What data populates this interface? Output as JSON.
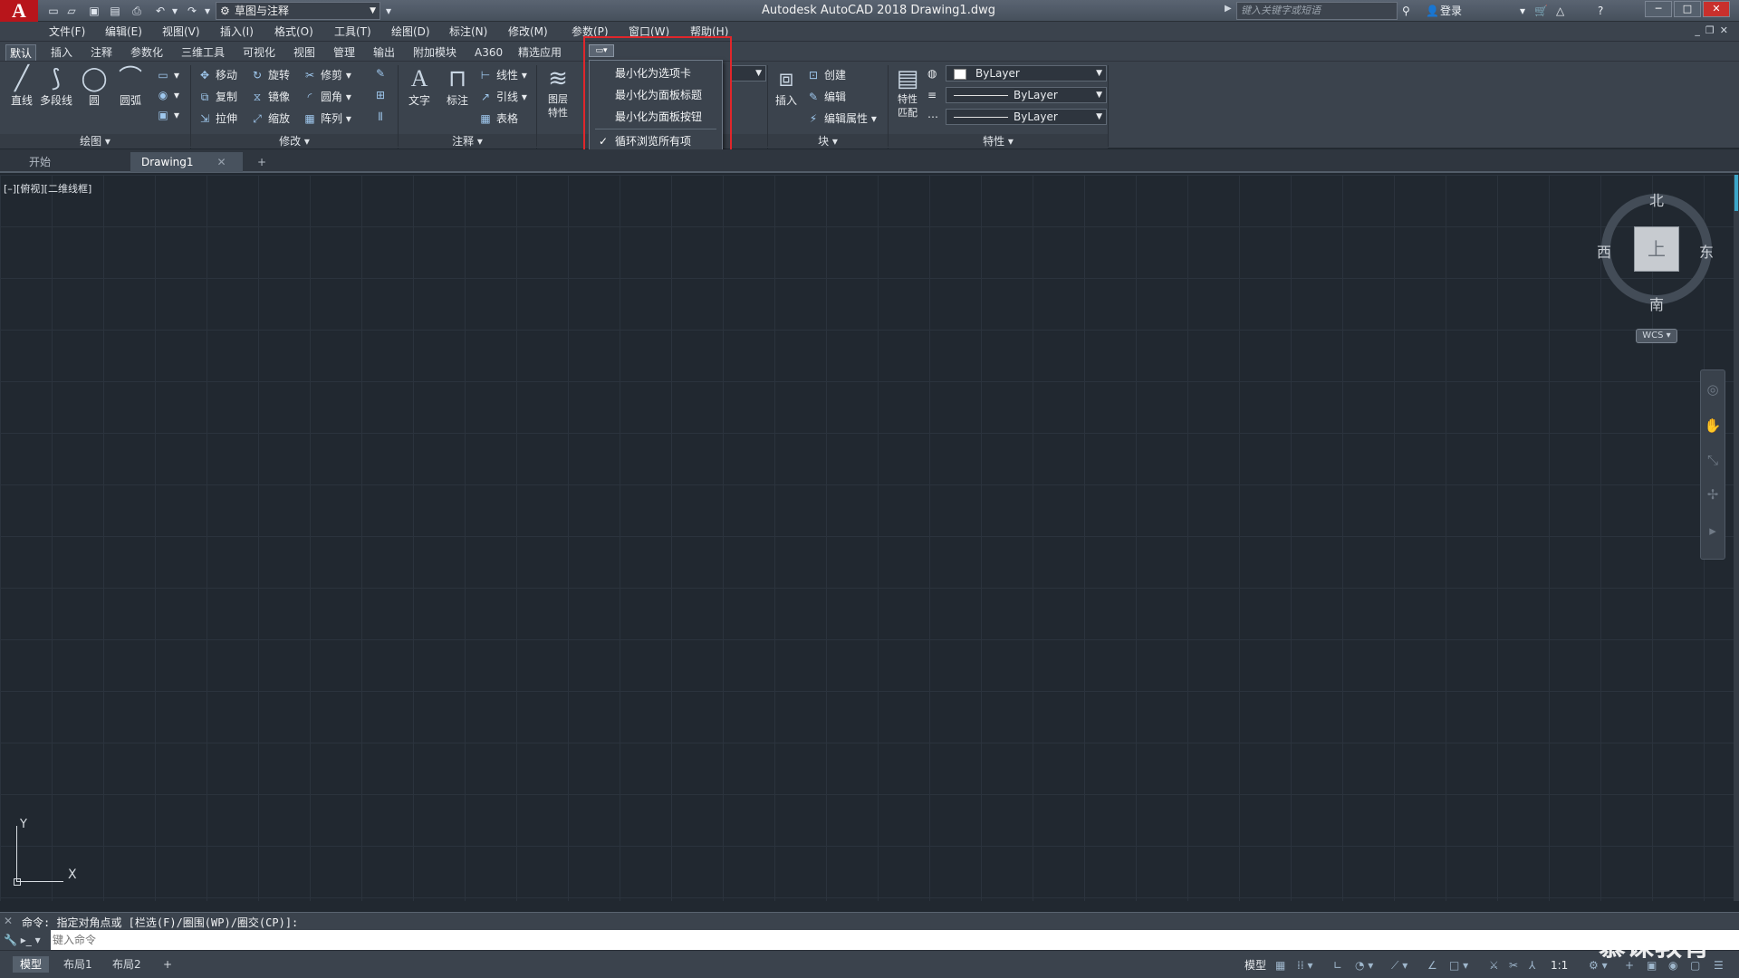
{
  "titlebar": {
    "logo": "A",
    "workspace": "草图与注释",
    "title": "Autodesk AutoCAD 2018    Drawing1.dwg",
    "search_placeholder": "键入关键字或短语",
    "login": "登录"
  },
  "menu": [
    "文件(F)",
    "编辑(E)",
    "视图(V)",
    "插入(I)",
    "格式(O)",
    "工具(T)",
    "绘图(D)",
    "标注(N)",
    "修改(M)",
    "参数(P)",
    "窗口(W)",
    "帮助(H)"
  ],
  "ribbon_tabs": [
    "默认",
    "插入",
    "注释",
    "参数化",
    "三维工具",
    "可视化",
    "视图",
    "管理",
    "输出",
    "附加模块",
    "A360",
    "精选应用"
  ],
  "ribbon": {
    "draw": {
      "title": "绘图",
      "line": "直线",
      "polyline": "多段线",
      "circle": "圆",
      "arc": "圆弧"
    },
    "modify": {
      "title": "修改",
      "move": "移动",
      "rotate": "旋转",
      "trim": "修剪",
      "copy": "复制",
      "mirror": "镜像",
      "fillet": "圆角",
      "stretch": "拉伸",
      "scale": "缩放",
      "array": "阵列"
    },
    "annotation": {
      "title": "注释",
      "text": "文字",
      "dimension": "标注",
      "linear": "线性",
      "leader": "引线",
      "table": "表格"
    },
    "layers": {
      "layer_props": "图层特性"
    },
    "block": {
      "title": "块",
      "insert": "插入",
      "create": "创建",
      "edit": "编辑",
      "edit_attr": "编辑属性"
    },
    "properties": {
      "title": "特性",
      "match": "特性匹配",
      "color": "ByLayer",
      "linetype": "ByLayer",
      "lineweight": "ByLayer"
    }
  },
  "context_menu": {
    "items": [
      "最小化为选项卡",
      "最小化为面板标题",
      "最小化为面板按钮",
      "循环浏览所有项"
    ],
    "checked_index": 3
  },
  "file_tabs": {
    "start": "开始",
    "drawing": "Drawing1",
    "add": "+"
  },
  "viewport_label": "[–][俯视][二维线框]",
  "viewcube": {
    "top": "上",
    "north": "北",
    "south": "南",
    "east": "东",
    "west": "西",
    "wcs": "WCS"
  },
  "ucs": {
    "x": "X",
    "y": "Y"
  },
  "command": {
    "history": "命令: 指定对角点或 [栏选(F)/圈围(WP)/圈交(CP)]:",
    "placeholder": "键入命令"
  },
  "layout_tabs": [
    "模型",
    "布局1",
    "布局2"
  ],
  "status": {
    "model": "模型",
    "scale": "1:1"
  },
  "watermark": "慕课教育",
  "colors": {
    "accent_red": "#e0262b",
    "canvas": "#212830",
    "logo_red": "#b8151b"
  }
}
